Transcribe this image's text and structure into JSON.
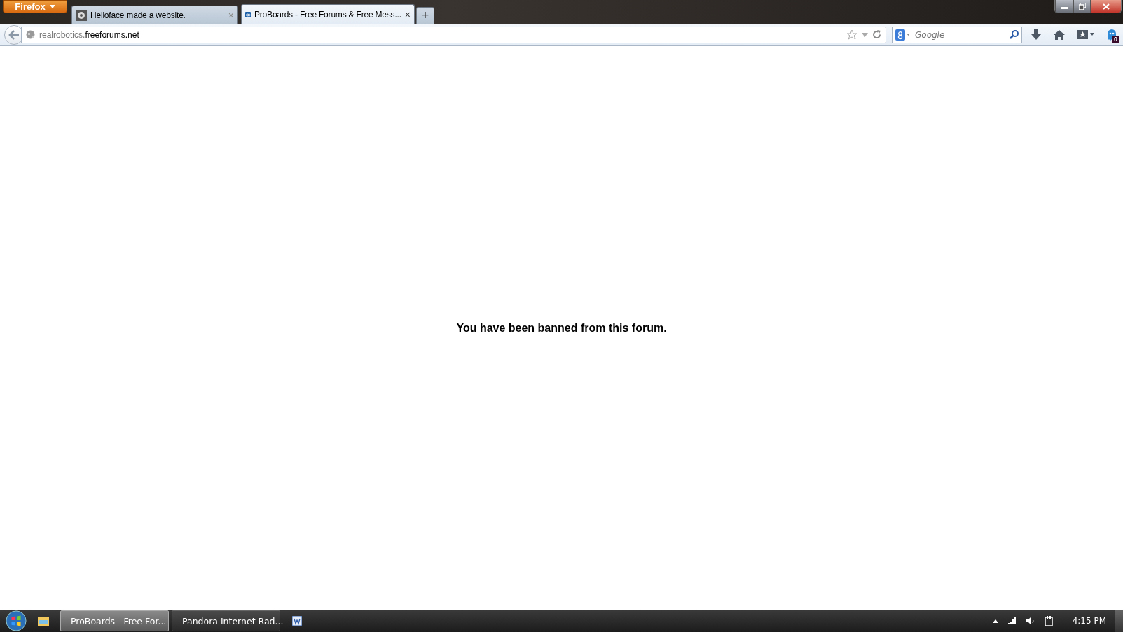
{
  "browser_menu": {
    "label": "Firefox"
  },
  "tabs": [
    {
      "title": "Helloface made a website.",
      "selected": false,
      "close": "×"
    },
    {
      "title": "ProBoards - Free Forums & Free Mess...",
      "selected": true,
      "close": "×"
    }
  ],
  "new_tab": "+",
  "address_bar": {
    "url_prefix": "realrobotics.",
    "url_domain": "freeforums.net"
  },
  "search": {
    "placeholder": "Google"
  },
  "addon_badge": "0",
  "page": {
    "message": "You have been banned from this forum."
  },
  "taskbar": {
    "buttons": [
      {
        "label": "ProBoards - Free For...",
        "selected": true
      },
      {
        "label": "Pandora Internet Rad...",
        "selected": false
      }
    ],
    "clock": "4:15 PM"
  }
}
